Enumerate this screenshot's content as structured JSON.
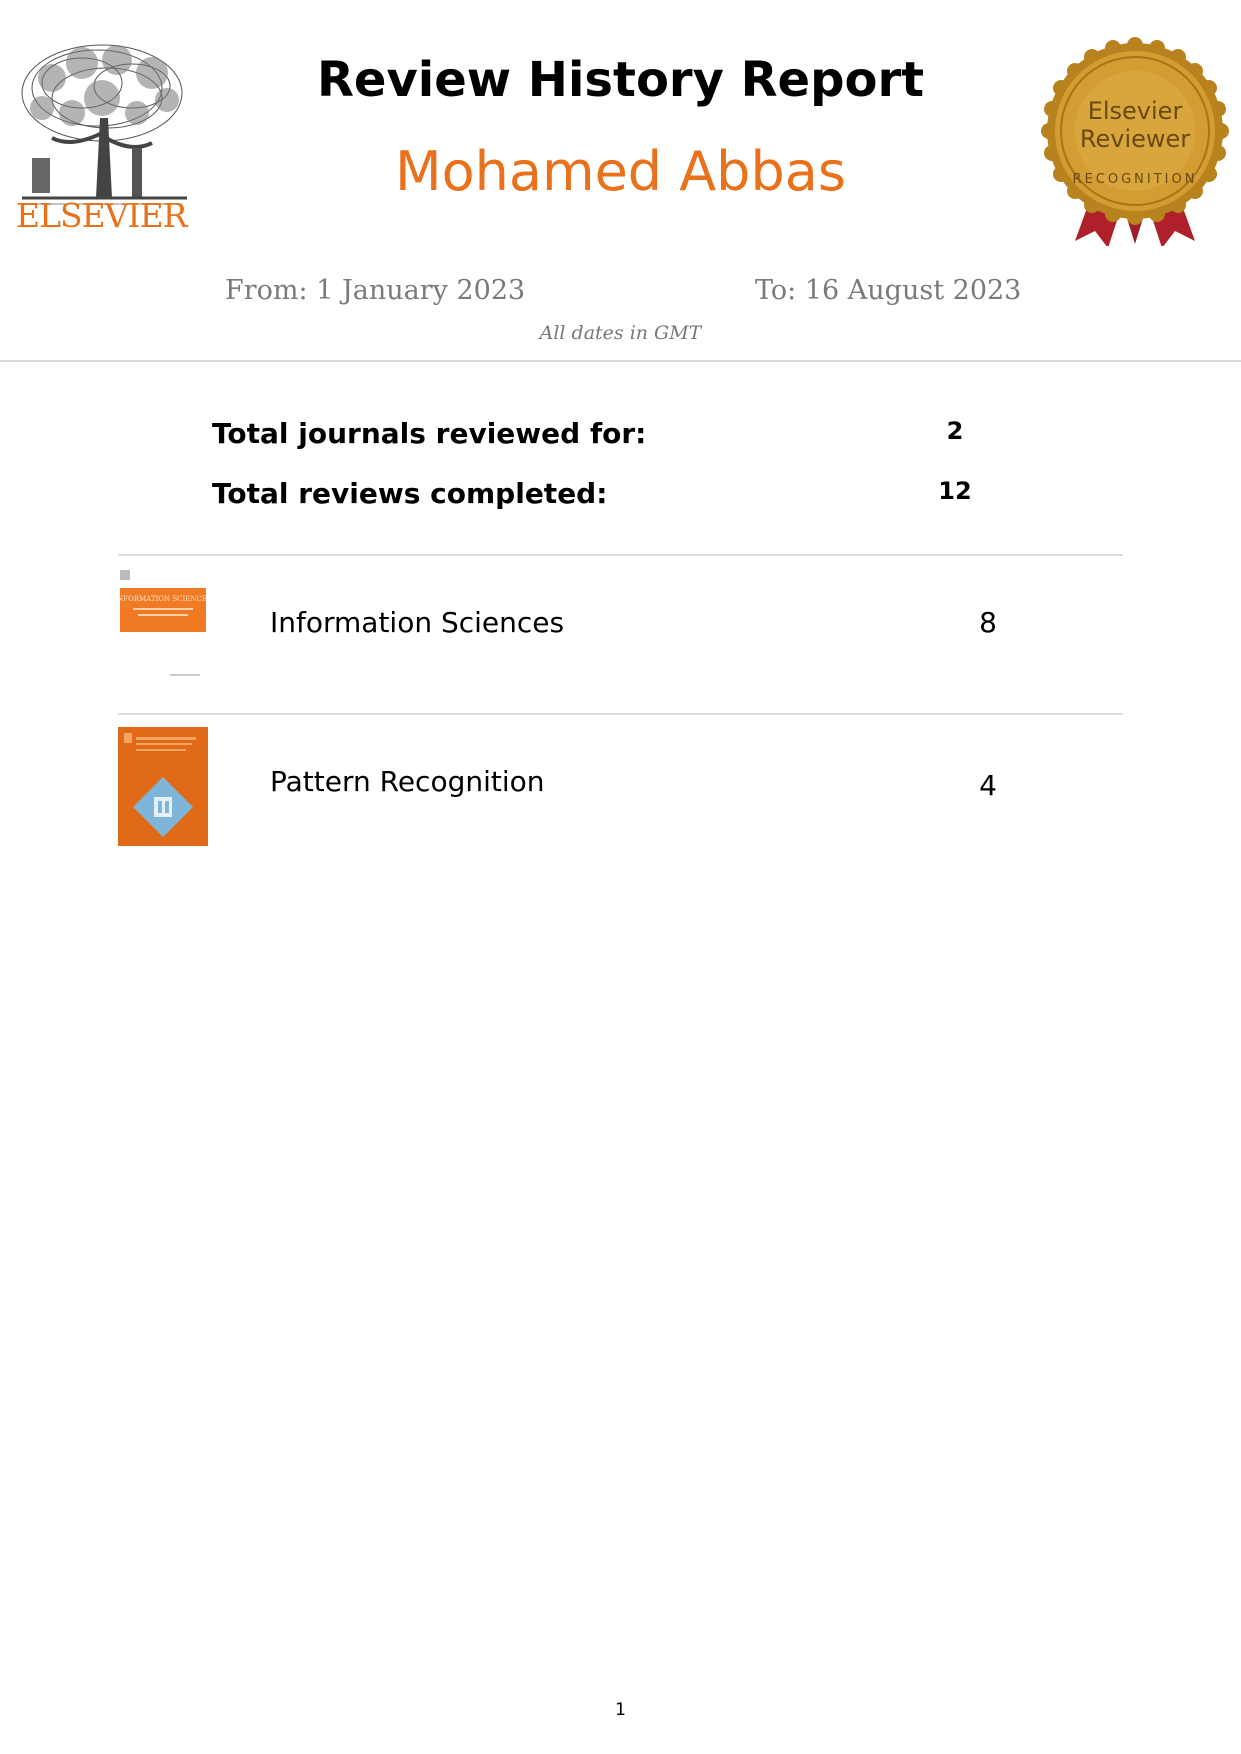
{
  "header": {
    "publisher_logo_text": "ELSEVIER",
    "title": "Review History Report",
    "reviewer_name": "Mohamed Abbas",
    "seal_line1": "Elsevier",
    "seal_line2": "Reviewer",
    "seal_arc": "RECOGNITION"
  },
  "date_range": {
    "from": "From: 1 January 2023",
    "to": "To: 16 August 2023",
    "timezone_note": "All dates in GMT"
  },
  "totals": {
    "journals_label": "Total journals reviewed for:",
    "journals_value": "2",
    "reviews_label": "Total reviews completed:",
    "reviews_value": "12"
  },
  "journals": [
    {
      "name": "Information Sciences",
      "count": "8",
      "cover_title": "INFORMATION SCIENCES"
    },
    {
      "name": "Pattern Recognition",
      "count": "4"
    }
  ],
  "colors": {
    "brand_orange": "#e9711c",
    "seal_gold": "#c9952c",
    "ribbon_red": "#b0202a"
  },
  "footer": {
    "page_number": "1"
  }
}
